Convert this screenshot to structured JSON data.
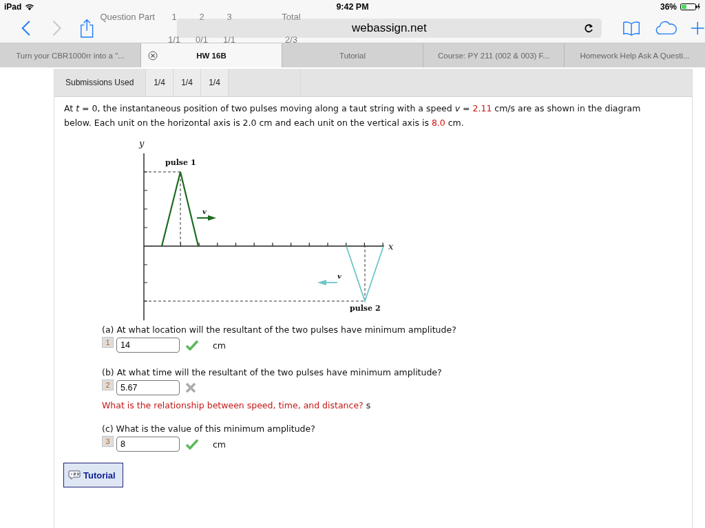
{
  "status_bar": {
    "device": "iPad",
    "time": "9:42 PM",
    "battery": "36%"
  },
  "ghost_table": {
    "header": [
      "Question Part",
      "1",
      "2",
      "3",
      "Total"
    ],
    "points": [
      "1/1",
      "0/1",
      "1/1",
      "2/3"
    ]
  },
  "toolbar": {
    "address": "webassign.net"
  },
  "tabs": [
    {
      "label": "Turn your CBR1000rr into a \"...",
      "selected": false
    },
    {
      "label": "HW 16B",
      "selected": true
    },
    {
      "label": "Tutorial",
      "selected": false
    },
    {
      "label": "Course: PY 211 (002 & 003) F...",
      "selected": false
    },
    {
      "label": "Homework Help Ask A Questi...",
      "selected": false
    }
  ],
  "submissions": {
    "label": "Submissions Used",
    "values": [
      "1/4",
      "1/4",
      "1/4"
    ]
  },
  "problem": {
    "intro": [
      {
        "kind": "text",
        "text": "At "
      },
      {
        "kind": "math",
        "text": "t"
      },
      {
        "kind": "text",
        "text": " = 0,  the instantaneous position of two pulses moving along a taut string with a speed  "
      },
      {
        "kind": "math",
        "text": "v"
      },
      {
        "kind": "text",
        "text": " = "
      },
      {
        "kind": "value",
        "text": "2.11"
      },
      {
        "kind": "text",
        "text": " cm/s  are as shown in the diagram below. Each unit on the horizontal axis is 2.0 cm and each unit on the vertical axis is "
      },
      {
        "kind": "value",
        "text": "8.0"
      },
      {
        "kind": "text",
        "text": " cm."
      }
    ],
    "diagram": {
      "y_label": "y",
      "x_label": "x",
      "pulse_1_label": "pulse 1",
      "pulse_2_label": "pulse 2",
      "velocity_1_label": "v",
      "velocity_2_label": "v"
    },
    "parts": [
      {
        "question": "(a) At what location will the resultant of the two pulses have minimum amplitude?",
        "number": "1",
        "answer": "14",
        "correct": true,
        "unit": "cm"
      },
      {
        "question": "(b) At what time will the resultant of the two pulses have minimum amplitude?",
        "number": "2",
        "answer": "5.67",
        "correct": false,
        "hint": "What is the relationship between speed, time, and distance?",
        "unit": "s"
      },
      {
        "question": "(c) What is the value of this minimum amplitude?",
        "number": "3",
        "answer": "8",
        "correct": true,
        "unit": "cm"
      }
    ]
  },
  "tutorial_button": {
    "label": "Tutorial"
  }
}
